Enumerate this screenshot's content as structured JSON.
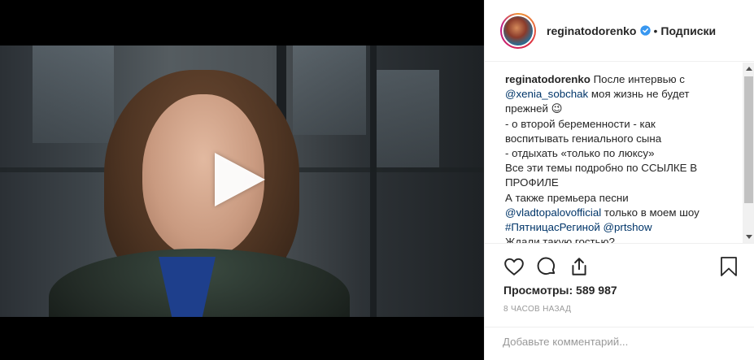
{
  "post": {
    "username": "reginatodorenko",
    "separator": "•",
    "follow_label": "Подписки"
  },
  "caption": {
    "username": "reginatodorenko",
    "line1_text": "После интервью с",
    "mention1": "@xenia_sobchak",
    "line2_text": " моя жизнь не будет",
    "line3": "прежней 😉",
    "line4": "- о второй беременности - как",
    "line5": "воспитывать гениального сына",
    "line6": "- отдыхать «только по люксу»",
    "line7": "Все эти темы подробно по ССЫЛКЕ В",
    "line8": "ПРОФИЛЕ",
    "line9": "А также премьера песни",
    "mention2": "@vladtopalovofficial",
    "line10_text": " только в моем шоу",
    "hashtag": "#ПятницасРегиной",
    "mention3": "@prtshow",
    "line12": "Ждали такую гостью?"
  },
  "stats": {
    "views": "Просмотры: 589 987",
    "time": "8 часов назад"
  },
  "comment": {
    "placeholder": "Добавьте комментарий..."
  },
  "icons": [
    "play-icon",
    "verified-icon",
    "heart-icon",
    "comment-icon",
    "share-icon",
    "bookmark-icon"
  ],
  "colors": {
    "link": "#003569",
    "verified": "#3897f0",
    "meta": "#999999"
  }
}
